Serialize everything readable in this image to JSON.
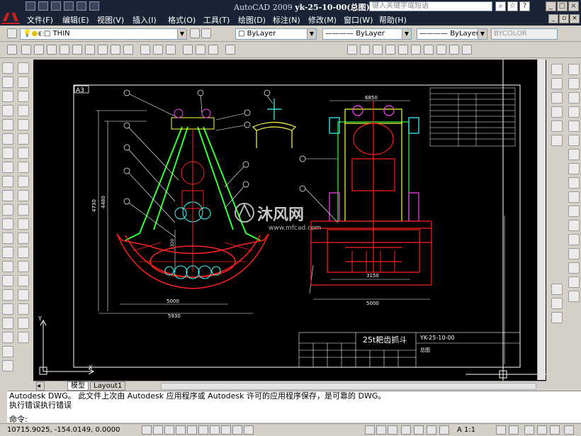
{
  "app": {
    "title_prefix": "AutoCAD 2009",
    "title_file": "yk-25-10-00(总图)",
    "search_placeholder": "键入关键字或短语"
  },
  "menu": [
    "文件(F)",
    "编辑(E)",
    "视图(V)",
    "插入(I)",
    "格式(O)",
    "工具(T)",
    "绘图(D)",
    "标注(N)",
    "修改(M)",
    "窗口(W)",
    "帮助(H)"
  ],
  "properties": {
    "layer": "THIN",
    "color": "ByLayer",
    "linetype": "ByLayer",
    "lineweight": "ByLayer",
    "plotstyle": "BYCOLOR"
  },
  "tabs": [
    "模型",
    "Layout1"
  ],
  "command": {
    "line1": "Autodesk DWG。  此文件上次由 Autodesk 应用程序或 Autodesk 许可的应用程序保存，是可靠的 DWG。",
    "line2": "执行错误执行错误",
    "prompt": "命令:"
  },
  "status": {
    "coords": "10715.9025, -154.0149, 0.0000",
    "scale": "A 1:1"
  },
  "drawing": {
    "sheet": "A3",
    "title_block_title": "25t耙齿抓斗",
    "drawing_no": "YK-25-10-00",
    "drawing_name": "总图",
    "dims": {
      "left_width": "5000",
      "left_total": "5930",
      "right_width": "5000",
      "height1": "4730",
      "height2": "4480",
      "top_width": "6850",
      "bottom_gap": "3150",
      "inner": "1320"
    },
    "watermark_main": "沐风网",
    "watermark_sub": "www.mfcad.com",
    "balloons": [
      "1",
      "2",
      "3",
      "4",
      "5",
      "6",
      "7",
      "8",
      "9",
      "10",
      "11",
      "12",
      "13",
      "14"
    ]
  },
  "colors": {
    "drawing_bg": "#000000",
    "red": "#ff2020",
    "green": "#30ff30",
    "yellow": "#ffff40",
    "cyan": "#40ffff",
    "magenta": "#ff40ff",
    "white": "#ffffff",
    "title_bar": "#1b2436"
  }
}
